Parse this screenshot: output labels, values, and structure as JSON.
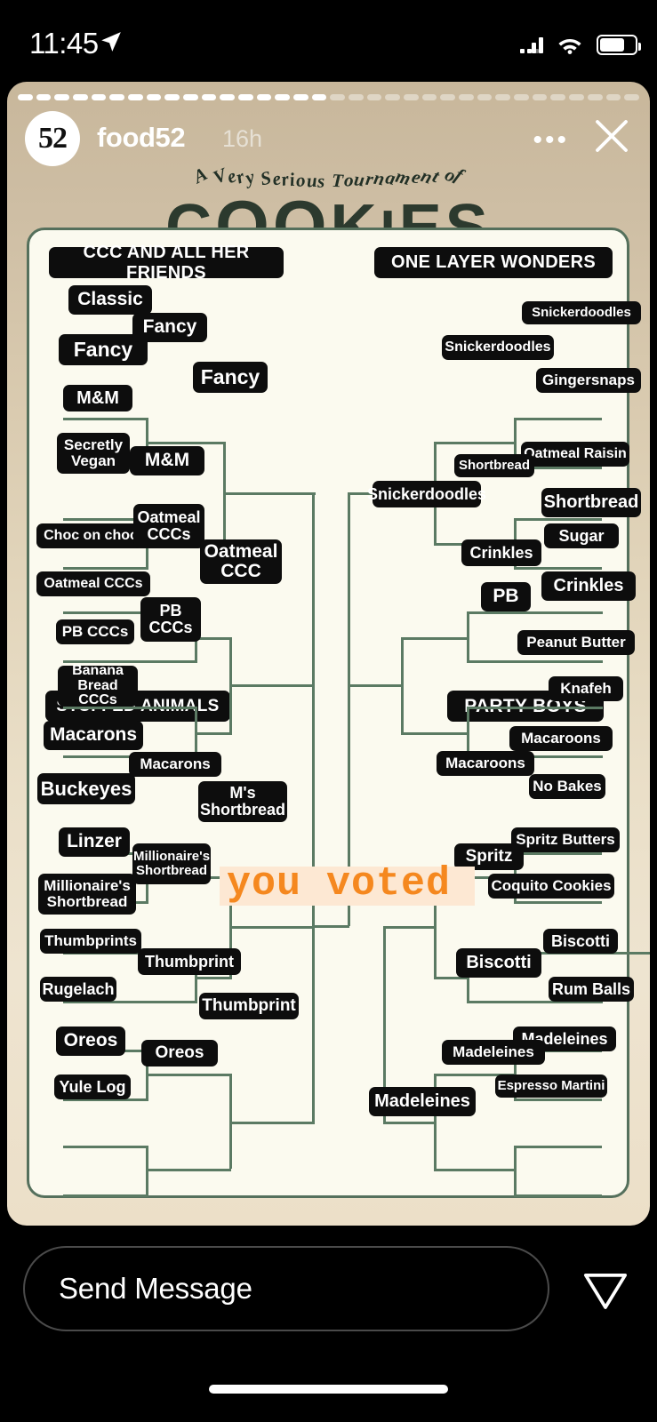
{
  "status_bar": {
    "time": "11:45",
    "location_icon": "location-arrow-icon",
    "signal_icon": "cellular-signal-icon",
    "wifi_icon": "wifi-icon",
    "battery_icon": "battery-icon"
  },
  "story": {
    "avatar_label": "52",
    "username": "food52",
    "timestamp": "16h",
    "more_label": "•••",
    "close_icon": "close-icon",
    "segments_total": 34,
    "segments_seen": 17
  },
  "poster": {
    "kicker": "A Very Serious Tournament of",
    "title": "COOKIES",
    "sticker": "you voted",
    "colors": {
      "card_bg": "#fbfaef",
      "line": "#5b7a63",
      "chip_bg": "#0d0d0d",
      "chip_text": "#ffffff",
      "accent_orange": "#f5881f",
      "sticker_bg": "#fde8d3",
      "title_green": "#2c3a2e"
    }
  },
  "chart_data": {
    "type": "diagram",
    "title": "A Very Serious Tournament of COOKIES",
    "subtype": "single-elimination-bracket",
    "regions": [
      {
        "name": "CCC AND ALL HER FRIENDS",
        "position": "top-left",
        "round1": [
          "Classic",
          "Fancy",
          "M&M",
          "Secretly Vegan",
          "Choc on choc",
          "Oatmeal CCCs",
          "PB CCCs",
          "Banana Bread CCCs"
        ],
        "round2": [
          "Fancy",
          "M&M",
          "Oatmeal CCCs",
          "PB CCCs"
        ],
        "round3": [
          "Fancy",
          "Oatmeal CCC"
        ]
      },
      {
        "name": "ONE LAYER WONDERS",
        "position": "top-right",
        "round1": [
          "Snickerdoodles",
          "Gingersnaps",
          "Oatmeal Raisin",
          "Shortbread",
          "Sugar",
          "Crinkles",
          "Peanut Butter",
          "Knafeh"
        ],
        "round2": [
          "Snickerdoodles",
          "Shortbread",
          "Crinkles",
          "PB"
        ],
        "round3": [
          "Snickerdoodles"
        ]
      },
      {
        "name": "STUFFED ANIMALS",
        "position": "bottom-left",
        "round1": [
          "Macarons",
          "Buckeyes",
          "Linzer",
          "Millionaire's Shortbread",
          "Thumbprints",
          "Rugelach",
          "Oreos",
          "Yule Log"
        ],
        "round2": [
          "Macarons",
          "Millionaire's Shortbread",
          "Thumbprint",
          "Oreos"
        ],
        "round3": [
          "M's Shortbread",
          "Thumbprint"
        ]
      },
      {
        "name": "PARTY BOYS",
        "position": "bottom-right",
        "round1": [
          "Macaroons",
          "No Bakes",
          "Spritz Butters",
          "Coquito Cookies",
          "Biscotti",
          "Rum Balls",
          "Madeleines",
          "Espresso Martini"
        ],
        "round2": [
          "Macaroons",
          "Spritz",
          "Biscotti",
          "Madeleines"
        ],
        "round3": [
          "Madeleines"
        ]
      }
    ]
  },
  "bracket": {
    "regions": [
      {
        "label": "CCC AND ALL HER FRIENDS"
      },
      {
        "label": "ONE LAYER WONDERS"
      },
      {
        "label": "STUFFED ANIMALS"
      },
      {
        "label": "PARTY BOYS"
      }
    ],
    "chips": [
      {
        "text": "Classic"
      },
      {
        "text": "Fancy"
      },
      {
        "text": "M&M"
      },
      {
        "text": "Secretly Vegan"
      },
      {
        "text": "Choc on choc"
      },
      {
        "text": "Oatmeal CCCs"
      },
      {
        "text": "PB CCCs"
      },
      {
        "text": "Banana Bread CCCs"
      },
      {
        "text": "Fancy"
      },
      {
        "text": "M&M"
      },
      {
        "text": "Oatmeal CCCs"
      },
      {
        "text": "PB CCCs"
      },
      {
        "text": "Fancy"
      },
      {
        "text": "Oatmeal CCC"
      },
      {
        "text": "Snickerdoodles"
      },
      {
        "text": "Gingersnaps"
      },
      {
        "text": "Oatmeal Raisin"
      },
      {
        "text": "Shortbread"
      },
      {
        "text": "Sugar"
      },
      {
        "text": "Crinkles"
      },
      {
        "text": "Peanut Butter"
      },
      {
        "text": "Knafeh"
      },
      {
        "text": "Snickerdoodles"
      },
      {
        "text": "Shortbread"
      },
      {
        "text": "Crinkles"
      },
      {
        "text": "PB"
      },
      {
        "text": "Snickerdoodles"
      },
      {
        "text": "Macarons"
      },
      {
        "text": "Buckeyes"
      },
      {
        "text": "Linzer"
      },
      {
        "text": "Millionaire's Shortbread"
      },
      {
        "text": "Thumbprints"
      },
      {
        "text": "Rugelach"
      },
      {
        "text": "Oreos"
      },
      {
        "text": "Yule Log"
      },
      {
        "text": "Macarons"
      },
      {
        "text": "Millionaire's Shortbread"
      },
      {
        "text": "Thumbprint"
      },
      {
        "text": "Oreos"
      },
      {
        "text": "M's Shortbread"
      },
      {
        "text": "Thumbprint"
      },
      {
        "text": "Macaroons"
      },
      {
        "text": "No Bakes"
      },
      {
        "text": "Spritz Butters"
      },
      {
        "text": "Coquito Cookies"
      },
      {
        "text": "Biscotti"
      },
      {
        "text": "Rum Balls"
      },
      {
        "text": "Madeleines"
      },
      {
        "text": "Espresso Martini"
      },
      {
        "text": "Macaroons"
      },
      {
        "text": "Spritz"
      },
      {
        "text": "Biscotti"
      },
      {
        "text": "Madeleines"
      },
      {
        "text": "Madeleines"
      }
    ]
  },
  "reply": {
    "placeholder": "Send Message",
    "share_icon": "share-paper-plane-icon"
  }
}
